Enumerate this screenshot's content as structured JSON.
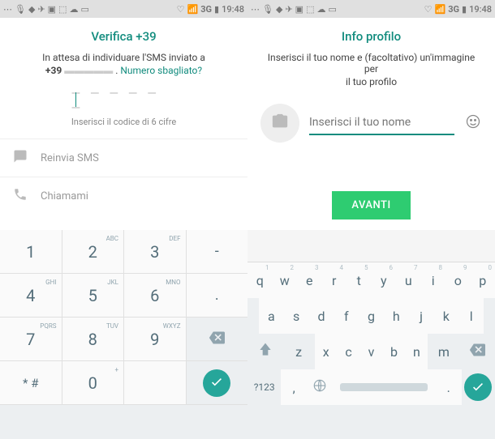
{
  "status": {
    "network": "3G",
    "time": "19:48"
  },
  "left": {
    "title": "Verifica +39",
    "waiting_line1": "In attesa di individuare l'SMS inviato a",
    "waiting_prefix": "+39",
    "wrong_number": "Numero sbagliato?",
    "dashes": "— — —  — — —",
    "hint": "Inserisci il codice di 6 cifre",
    "resend": "Reinvia SMS",
    "callme": "Chiamami"
  },
  "right": {
    "title": "Info profilo",
    "subtitle1": "Inserisci il tuo nome e (facoltativo) un'immagine per",
    "subtitle2": "il tuo profilo",
    "name_placeholder": "Inserisci il tuo nome",
    "next": "AVANTI"
  },
  "numpad": {
    "r1": [
      {
        "n": "1",
        "l": ""
      },
      {
        "n": "2",
        "l": "ABC"
      },
      {
        "n": "3",
        "l": "DEF"
      },
      {
        "n": "-",
        "l": ""
      }
    ],
    "r2": [
      {
        "n": "4",
        "l": "GHI"
      },
      {
        "n": "5",
        "l": "JKL"
      },
      {
        "n": "6",
        "l": "MNO"
      },
      {
        "n": ".",
        "l": ""
      }
    ],
    "r3": [
      {
        "n": "7",
        "l": "PQRS"
      },
      {
        "n": "8",
        "l": "TUV"
      },
      {
        "n": "9",
        "l": "WXYZ"
      }
    ],
    "r4": [
      {
        "n": "* #",
        "l": ""
      },
      {
        "n": "0",
        "l": "+"
      }
    ]
  },
  "qwerty": {
    "r1": [
      "q",
      "w",
      "e",
      "r",
      "t",
      "y",
      "u",
      "i",
      "o",
      "p"
    ],
    "r1n": [
      "1",
      "2",
      "3",
      "4",
      "5",
      "6",
      "7",
      "8",
      "9",
      "0"
    ],
    "r2": [
      "a",
      "s",
      "d",
      "f",
      "g",
      "h",
      "j",
      "k",
      "l"
    ],
    "r3": [
      "z",
      "x",
      "c",
      "v",
      "b",
      "n",
      "m"
    ],
    "sym": "?123",
    "comma": ",",
    "period": "."
  }
}
